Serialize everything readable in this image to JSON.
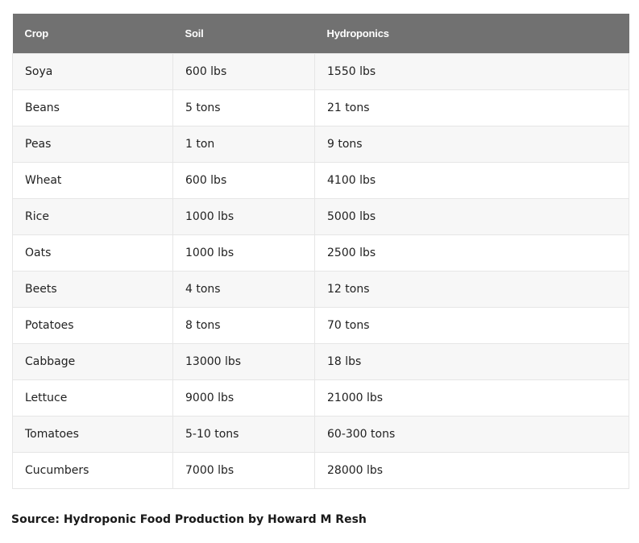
{
  "table": {
    "headers": [
      "Crop",
      "Soil",
      "Hydroponics"
    ],
    "rows": [
      [
        "Soya",
        "600 lbs",
        "1550 lbs"
      ],
      [
        "Beans",
        "5 tons",
        "21 tons"
      ],
      [
        "Peas",
        "1 ton",
        "9 tons"
      ],
      [
        "Wheat",
        "600 lbs",
        "4100 lbs"
      ],
      [
        "Rice",
        "1000 lbs",
        "5000 lbs"
      ],
      [
        "Oats",
        "1000 lbs",
        "2500 lbs"
      ],
      [
        "Beets",
        "4 tons",
        "12 tons"
      ],
      [
        "Potatoes",
        "8 tons",
        "70 tons"
      ],
      [
        "Cabbage",
        "13000 lbs",
        "18 lbs"
      ],
      [
        "Lettuce",
        "9000 lbs",
        "21000 lbs"
      ],
      [
        "Tomatoes",
        "5-10 tons",
        "60-300 tons"
      ],
      [
        "Cucumbers",
        "7000 lbs",
        "28000 lbs"
      ]
    ]
  },
  "source": "Source: Hydroponic Food Production by Howard M Resh",
  "colors": {
    "header_bg": "#717171",
    "header_text": "#ffffff",
    "row_stripe": "#f7f7f7",
    "border": "#e6e6e6"
  }
}
